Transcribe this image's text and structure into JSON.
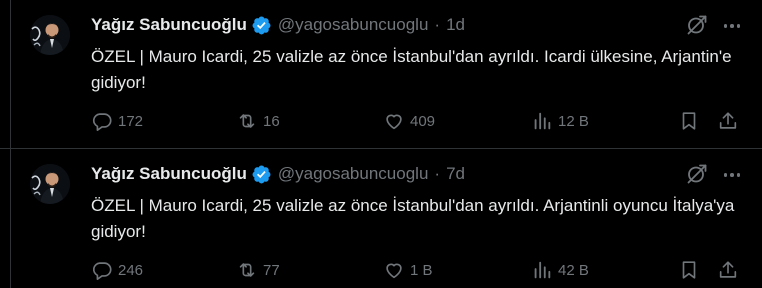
{
  "colors": {
    "background": "#000000",
    "text": "#e7e9ea",
    "muted": "#71767b",
    "divider": "#2f3336",
    "verified": "#1d9bf0"
  },
  "icons": {
    "verified": "verified-badge-icon",
    "grok": "grok-icon",
    "more": "more-options-icon",
    "reply": "reply-icon",
    "retweet": "retweet-icon",
    "like": "like-icon",
    "views": "views-icon",
    "bookmark": "bookmark-icon",
    "share": "share-icon"
  },
  "tweets": [
    {
      "author_name": "Yağız Sabuncuoğlu",
      "handle": "@yagosabuncuoglu",
      "separator": "·",
      "time": "1d",
      "text": "ÖZEL | Mauro Icardi, 25 valizle az önce İstanbul'dan ayrıldı. Icardi ülkesine, Arjantin'e gidiyor!",
      "replies": "172",
      "retweets": "16",
      "likes": "409",
      "views": "12 B"
    },
    {
      "author_name": "Yağız Sabuncuoğlu",
      "handle": "@yagosabuncuoglu",
      "separator": "·",
      "time": "7d",
      "text": "ÖZEL | Mauro Icardi, 25 valizle az önce İstanbul'dan ayrıldı. Arjantinli oyuncu İtalya'ya gidiyor!",
      "replies": "246",
      "retweets": "77",
      "likes": "1 B",
      "views": "42 B"
    }
  ]
}
